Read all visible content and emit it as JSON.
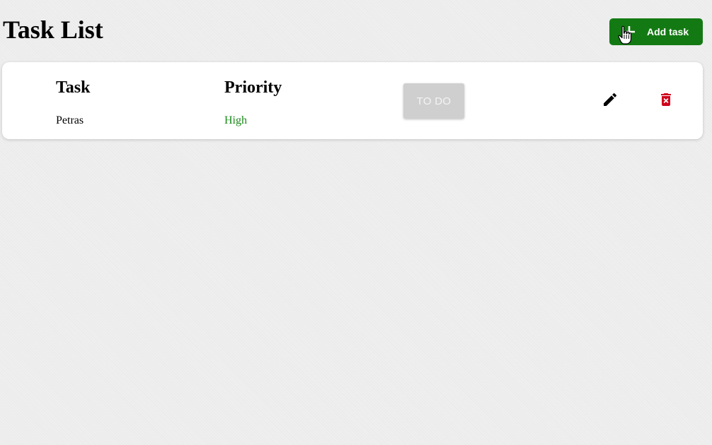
{
  "header": {
    "title": "Task List",
    "add_button_label": "Add task"
  },
  "tasks": [
    {
      "task_heading": "Task",
      "task_name": "Petras",
      "priority_heading": "Priority",
      "priority": "High",
      "status": "TO DO"
    }
  ],
  "colors": {
    "add_button": "#137a13",
    "priority_high": "#1a8a1a",
    "delete_icon": "#d0021b",
    "status_disabled": "#cfcfcf"
  },
  "icons": {
    "add": "plus-icon",
    "edit": "pencil-icon",
    "delete": "trash-icon",
    "cursor": "hand-pointer-icon"
  }
}
